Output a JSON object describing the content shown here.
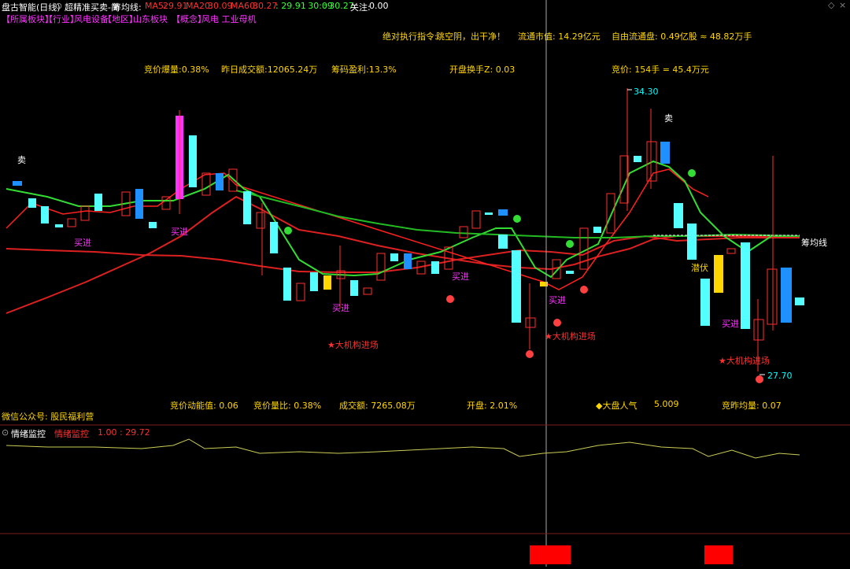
{
  "window": {
    "title": "盘古智能(日线)",
    "indicator_name": "超精准买卖-简",
    "chips_label": "筹均线:",
    "ma_values": [
      {
        "label": "MA5:",
        "value": "29.91"
      },
      {
        "label": "MA20:",
        "value": "30.09"
      },
      {
        "label": "MA60:",
        "value": "30.27"
      }
    ],
    "extra_vals": [
      ": 29.91",
      ": 30:09",
      ": 30.27"
    ],
    "focus_label": "关注:",
    "focus_value": "0.00"
  },
  "sector_bar": [
    {
      "tag": "【所属板块】",
      "text": ""
    },
    {
      "tag": "【行业】",
      "text": "风电设备"
    },
    {
      "tag": "【地区】",
      "text": "山东板块"
    },
    {
      "tag": "【概念】",
      "text": "风电 工业母机"
    }
  ],
  "top_stats": {
    "absolute_cmd_label": "绝对执行指令:",
    "absolute_cmd_value": "跳空阴，出干净！",
    "float_mv": "流通市值: 14.29亿元",
    "free_float": "自由流通盘: 0.49亿股 ≈ 48.82万手",
    "bid_volume": "竞价爆量:0.38%",
    "prev_turnover": "昨日成交额:12065.24万",
    "chip_profit": "筹码盈利:13.3%",
    "open_turnover": "开盘换手Z: 0.03",
    "bid_price": "竞价: 154手 = 45.4万元"
  },
  "chart_labels": {
    "high": "34.30",
    "low": "27.70",
    "sell_1": "卖",
    "sell_2": "卖",
    "buy_1": "买进",
    "buy_2": "买进",
    "buy_3": "买进",
    "buy_4": "买进",
    "buy_5": "买进",
    "buy_6": "买进",
    "inst_1": "★大机构进场",
    "inst_2": "★大机构进场",
    "inst_3": "★大机构进场",
    "enter": "进",
    "chips_line": "筹均线",
    "hold_label": "潜伏"
  },
  "bottom_stats": {
    "bid_momentum": "竞价动能值: 0.06",
    "bid_ratio": "竞价量比: 0.38%",
    "turnover": "成交额: 7265.08万",
    "open": "开盘: 2.01%",
    "market_pop_label": "◆大盘人气",
    "market_pop_value": "5.009",
    "bid_avg": "竞昨均量: 0.07",
    "wechat": "微信公众号: 股民福利营"
  },
  "sentiment_panel": {
    "title": "情绪监控",
    "label": "情绪监控",
    "values": "1.00 : 29.72"
  },
  "chart_data": {
    "type": "candlestick",
    "high_marker": 34.3,
    "low_marker": 27.7,
    "ma_values": {
      "MA5": 29.91,
      "MA20": 30.09,
      "MA60": 30.27
    }
  },
  "colors": {
    "up": "#ff3030",
    "down": "#55ffff",
    "ma_green": "#33dd33",
    "ma_red": "#dd2020",
    "accent_magenta": "#ff33ff",
    "accent_yellow": "#ffd700"
  }
}
